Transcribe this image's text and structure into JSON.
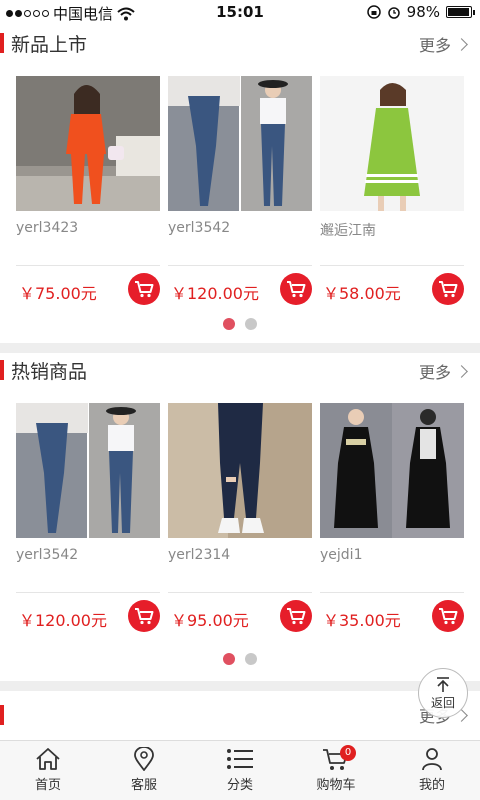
{
  "status_bar": {
    "carrier": "中国电信",
    "time": "15:01",
    "battery": "98%"
  },
  "sections": [
    {
      "title": "新品上市",
      "more": "更多",
      "products": [
        {
          "name": "yerl3423",
          "price": "￥75.00元"
        },
        {
          "name": "yerl3542",
          "price": "￥120.00元"
        },
        {
          "name": "邂逅江南",
          "price": "￥58.00元"
        }
      ]
    },
    {
      "title": "热销商品",
      "more": "更多",
      "products": [
        {
          "name": "yerl3542",
          "price": "￥120.00元"
        },
        {
          "name": "yerl2314",
          "price": "￥95.00元"
        },
        {
          "name": "yejdi1",
          "price": "￥35.00元"
        }
      ]
    },
    {
      "title": "",
      "more": "更多"
    }
  ],
  "back_to_top": "返回",
  "tabbar": [
    {
      "label": "首页",
      "icon": "home-icon"
    },
    {
      "label": "客服",
      "icon": "location-pin-icon"
    },
    {
      "label": "分类",
      "icon": "list-icon"
    },
    {
      "label": "购物车",
      "icon": "cart-icon",
      "badge": "0"
    },
    {
      "label": "我的",
      "icon": "user-icon"
    }
  ],
  "colors": {
    "accent": "#e02020",
    "cart_button": "#e61e2a",
    "dot_active": "#e05060"
  }
}
